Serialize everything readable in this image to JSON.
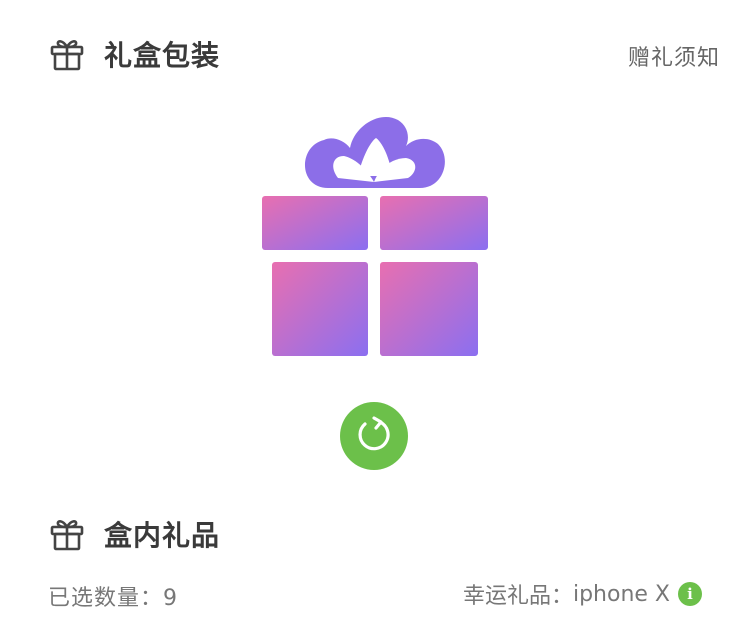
{
  "packaging": {
    "title": "礼盒包装",
    "notice_link": "赠礼须知",
    "icon": "gift-icon"
  },
  "refresh": {
    "icon": "refresh-icon",
    "color": "#6cc04a"
  },
  "contents": {
    "title": "盒内礼品",
    "icon": "gift-icon",
    "selected_label": "已选数量：",
    "selected_count": "9",
    "lucky_label": "幸运礼品：",
    "lucky_value": "iphone X",
    "info_icon": "info-icon",
    "info_glyph": "i"
  },
  "colors": {
    "gift_gradient_start": "#e86fb0",
    "gift_gradient_end": "#8b6ff0",
    "bow": "#8c6ee8",
    "accent_green": "#6cc04a"
  }
}
